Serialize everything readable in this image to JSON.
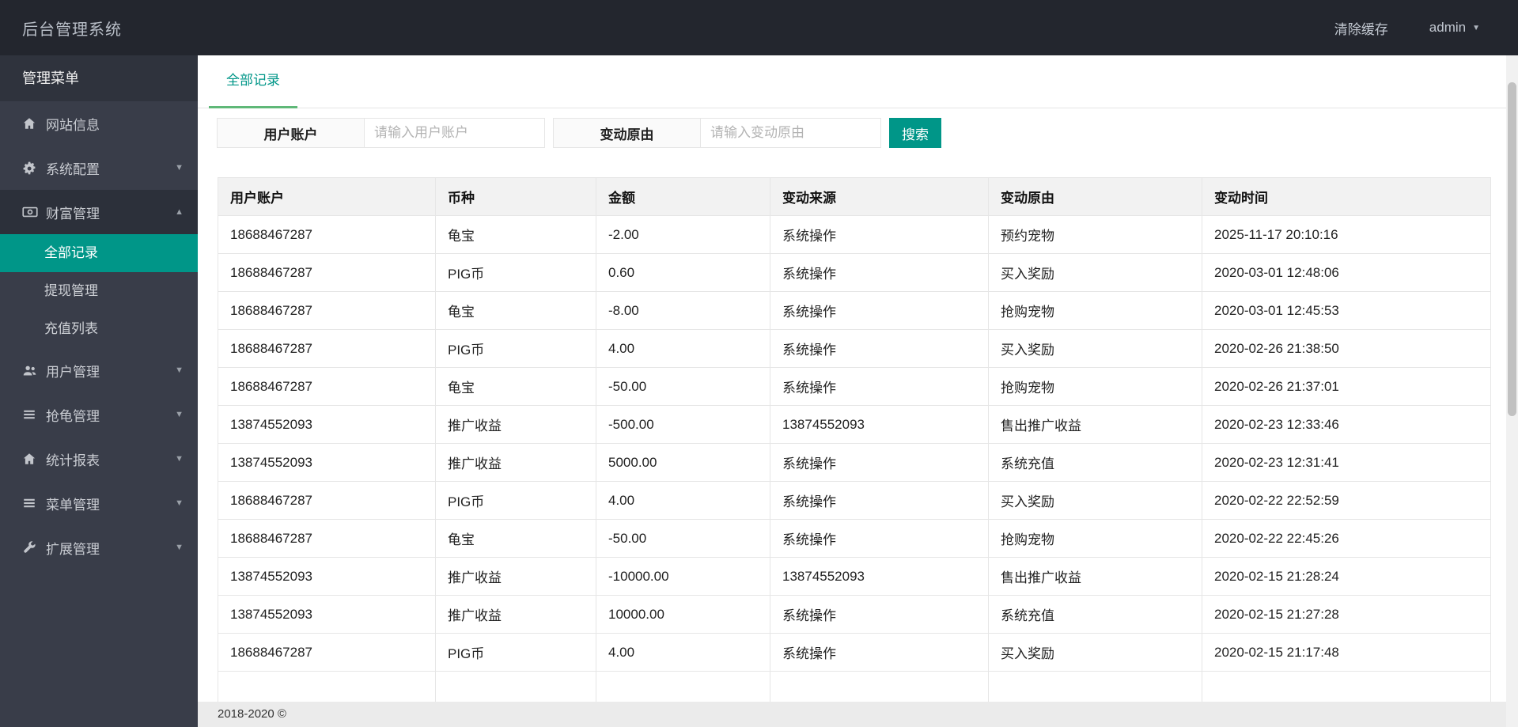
{
  "header": {
    "brand": "后台管理系统",
    "clear_cache": "清除缓存",
    "user": "admin"
  },
  "sidebar": {
    "title": "管理菜单",
    "items": [
      {
        "label": "网站信息",
        "icon": "home-icon",
        "caret": null
      },
      {
        "label": "系统配置",
        "icon": "gears-icon",
        "caret": "down"
      },
      {
        "label": "财富管理",
        "icon": "money-icon",
        "caret": "up",
        "expanded": true,
        "children": [
          {
            "label": "全部记录",
            "active": true
          },
          {
            "label": "提现管理",
            "active": false
          },
          {
            "label": "充值列表",
            "active": false
          }
        ]
      },
      {
        "label": "用户管理",
        "icon": "users-icon",
        "caret": "down"
      },
      {
        "label": "抢龟管理",
        "icon": "list-icon",
        "caret": "down"
      },
      {
        "label": "统计报表",
        "icon": "home-icon",
        "caret": "down"
      },
      {
        "label": "菜单管理",
        "icon": "list-icon",
        "caret": "down"
      },
      {
        "label": "扩展管理",
        "icon": "wrench-icon",
        "caret": "down"
      }
    ]
  },
  "tabs": {
    "active": "全部记录"
  },
  "filters": {
    "account_label": "用户账户",
    "account_placeholder": "请输入用户账户",
    "account_value": "",
    "reason_label": "变动原由",
    "reason_placeholder": "请输入变动原由",
    "reason_value": "",
    "search_label": "搜索"
  },
  "table": {
    "columns": [
      "用户账户",
      "币种",
      "金额",
      "变动来源",
      "变动原由",
      "变动时间"
    ],
    "rows": [
      [
        "18688467287",
        "龟宝",
        "-2.00",
        "系统操作",
        "预约宠物",
        "2025-11-17 20:10:16"
      ],
      [
        "18688467287",
        "PIG币",
        "0.60",
        "系统操作",
        "买入奖励",
        "2020-03-01 12:48:06"
      ],
      [
        "18688467287",
        "龟宝",
        "-8.00",
        "系统操作",
        "抢购宠物",
        "2020-03-01 12:45:53"
      ],
      [
        "18688467287",
        "PIG币",
        "4.00",
        "系统操作",
        "买入奖励",
        "2020-02-26 21:38:50"
      ],
      [
        "18688467287",
        "龟宝",
        "-50.00",
        "系统操作",
        "抢购宠物",
        "2020-02-26 21:37:01"
      ],
      [
        "13874552093",
        "推广收益",
        "-500.00",
        "13874552093",
        "售出推广收益",
        "2020-02-23 12:33:46"
      ],
      [
        "13874552093",
        "推广收益",
        "5000.00",
        "系统操作",
        "系统充值",
        "2020-02-23 12:31:41"
      ],
      [
        "18688467287",
        "PIG币",
        "4.00",
        "系统操作",
        "买入奖励",
        "2020-02-22 22:52:59"
      ],
      [
        "18688467287",
        "龟宝",
        "-50.00",
        "系统操作",
        "抢购宠物",
        "2020-02-22 22:45:26"
      ],
      [
        "13874552093",
        "推广收益",
        "-10000.00",
        "13874552093",
        "售出推广收益",
        "2020-02-15 21:28:24"
      ],
      [
        "13874552093",
        "推广收益",
        "10000.00",
        "系统操作",
        "系统充值",
        "2020-02-15 21:27:28"
      ],
      [
        "18688467287",
        "PIG币",
        "4.00",
        "系统操作",
        "买入奖励",
        "2020-02-15 21:17:48"
      ]
    ]
  },
  "footer": {
    "copyright": "2018-2020 ©"
  },
  "colors": {
    "accent": "#009688",
    "tab_underline": "#5FB878",
    "header_bg": "#23262E",
    "sidebar_bg": "#393D49",
    "border": "#e6e6e6"
  }
}
